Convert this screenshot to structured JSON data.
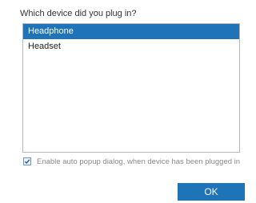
{
  "dialog": {
    "question": "Which device did you plug in?",
    "devices": [
      {
        "label": "Headphone",
        "selected": true
      },
      {
        "label": "Headset",
        "selected": false
      }
    ],
    "auto_popup": {
      "checked": true,
      "label": "Enable auto popup dialog, when device has been plugged in"
    },
    "ok_label": "OK"
  },
  "colors": {
    "accent": "#1e73b9",
    "muted_text": "#8a8a8a"
  }
}
